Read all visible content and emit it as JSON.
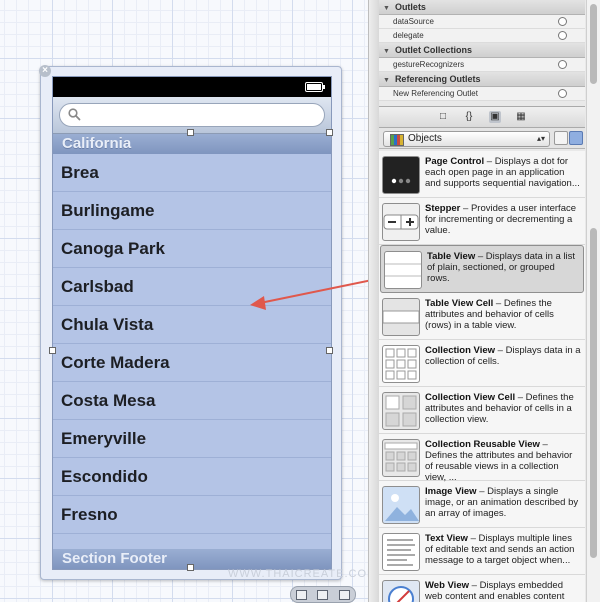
{
  "canvas": {
    "section_header": "California",
    "cities": [
      "Brea",
      "Burlingame",
      "Canoga Park",
      "Carlsbad",
      "Chula Vista",
      "Corte Madera",
      "Costa Mesa",
      "Emeryville",
      "Escondido",
      "Fresno"
    ],
    "section_footer": "Section Footer",
    "watermark": "WWW.THAICREATE.COM"
  },
  "connections": {
    "outlets_label": "Outlets",
    "outlets": [
      "dataSource",
      "delegate"
    ],
    "outlet_collections_label": "Outlet Collections",
    "outlet_collections": [
      "gestureRecognizers"
    ],
    "referencing_outlets_label": "Referencing Outlets",
    "referencing_outlets": [
      "New Referencing Outlet"
    ]
  },
  "library": {
    "selector": "Objects",
    "items": [
      {
        "title": "Page Control",
        "desc": "Displays a dot for each open page in an application and supports sequential navigation..."
      },
      {
        "title": "Stepper",
        "desc": "Provides a user interface for incrementing or decrementing a value."
      },
      {
        "title": "Table View",
        "desc": "Displays data in a list of plain, sectioned, or grouped rows."
      },
      {
        "title": "Table View Cell",
        "desc": "Defines the attributes and behavior of cells (rows) in a table view."
      },
      {
        "title": "Collection View",
        "desc": "Displays data in a collection of cells."
      },
      {
        "title": "Collection View Cell",
        "desc": "Defines the attributes and behavior of cells in a collection view."
      },
      {
        "title": "Collection Reusable View",
        "desc": "Defines the attributes and behavior of reusable views in a collection view, ..."
      },
      {
        "title": "Image View",
        "desc": "Displays a single image, or an animation described by an array of images."
      },
      {
        "title": "Text View",
        "desc": "Displays multiple lines of editable text and sends an action message to a target object when..."
      },
      {
        "title": "Web View",
        "desc": "Displays embedded web content and enables content"
      }
    ]
  }
}
